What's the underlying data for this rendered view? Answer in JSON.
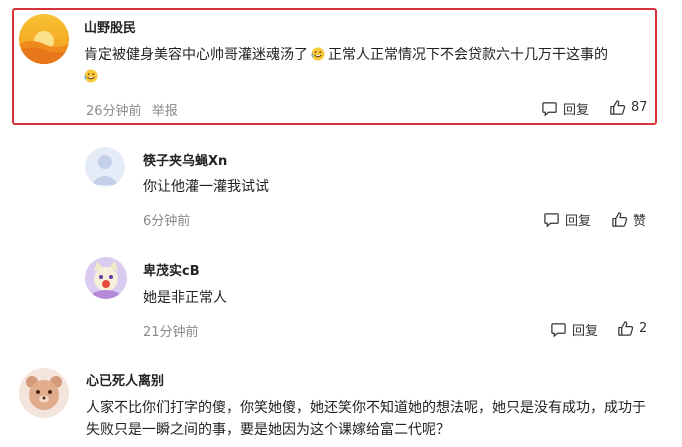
{
  "comments": [
    {
      "user": "山野股民",
      "text_part1": "肯定被健身美容中心帅哥灌迷魂汤了",
      "text_part2": "正常人正常情况下不会贷款六十几万干这事的",
      "time": "26分钟前",
      "report": "举报",
      "reply_label": "回复",
      "like_count": "87",
      "highlighted": true
    },
    {
      "user": "筷子夹乌蝇Xn",
      "text": "你让他灌一灌我试试",
      "time": "6分钟前",
      "reply_label": "回复",
      "like_label": "赞"
    },
    {
      "user": "卑茂实cB",
      "text": "她是非正常人",
      "time": "21分钟前",
      "reply_label": "回复",
      "like_count": "2"
    },
    {
      "user": "心已死人离别",
      "text": "人家不比你们打字的傻，你笑她傻，她还笑你不知道她的想法呢，她只是没有成功，成功于失败只是一瞬之间的事，要是她因为这个课嫁给富二代呢？"
    }
  ],
  "colors": {
    "highlight_border": "#d9323a",
    "meta_text": "#8a8a8a"
  }
}
